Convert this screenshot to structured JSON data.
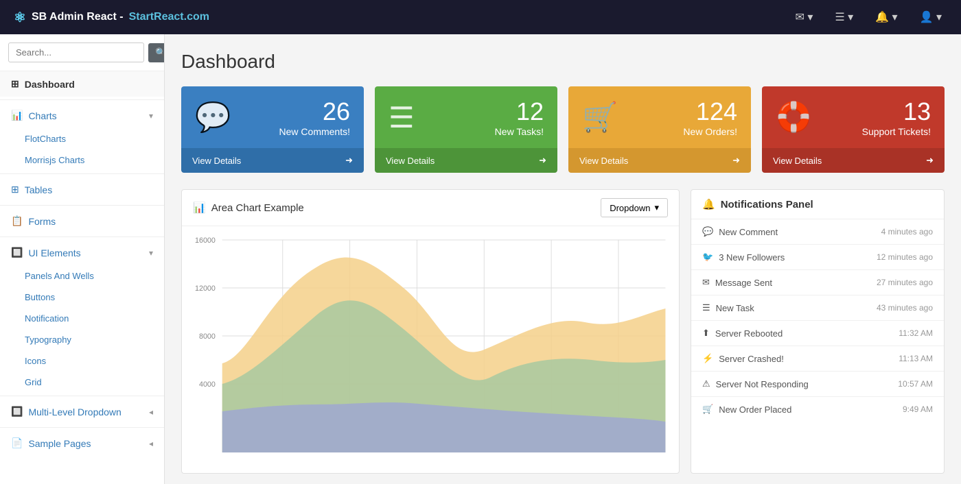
{
  "brand": {
    "icon": "⚛",
    "text": "SB Admin React - ",
    "link": "StartReact.com"
  },
  "topnav": {
    "icons": [
      {
        "name": "mail-icon",
        "symbol": "✉",
        "label": "Mail"
      },
      {
        "name": "list-icon",
        "symbol": "☰",
        "label": "List"
      },
      {
        "name": "bell-icon",
        "symbol": "🔔",
        "label": "Notifications"
      },
      {
        "name": "user-icon",
        "symbol": "👤",
        "label": "User"
      }
    ]
  },
  "sidebar": {
    "search_placeholder": "Search...",
    "items": [
      {
        "id": "dashboard",
        "label": "Dashboard",
        "icon": "⊞",
        "active": true,
        "hasChildren": false
      },
      {
        "id": "charts",
        "label": "Charts",
        "icon": "📊",
        "active": false,
        "hasChildren": true
      },
      {
        "id": "flot-charts",
        "label": "FlotCharts",
        "sub": true
      },
      {
        "id": "morrisjs-charts",
        "label": "Morrisjs Charts",
        "sub": true
      },
      {
        "id": "tables",
        "label": "Tables",
        "icon": "⊞",
        "active": false,
        "hasChildren": false
      },
      {
        "id": "forms",
        "label": "Forms",
        "icon": "📋",
        "active": false,
        "hasChildren": false
      },
      {
        "id": "ui-elements",
        "label": "UI Elements",
        "icon": "🔲",
        "active": false,
        "hasChildren": true
      },
      {
        "id": "panels-wells",
        "label": "Panels And Wells",
        "sub": true
      },
      {
        "id": "buttons",
        "label": "Buttons",
        "sub": true
      },
      {
        "id": "notification",
        "label": "Notification",
        "sub": true
      },
      {
        "id": "typography",
        "label": "Typography",
        "sub": true
      },
      {
        "id": "icons",
        "label": "Icons",
        "sub": true
      },
      {
        "id": "grid",
        "label": "Grid",
        "sub": true
      },
      {
        "id": "multi-level",
        "label": "Multi-Level Dropdown",
        "icon": "🔲",
        "active": false,
        "hasChildren": true
      },
      {
        "id": "sample-pages",
        "label": "Sample Pages",
        "icon": "📄",
        "active": false,
        "hasChildren": true
      }
    ]
  },
  "page": {
    "title": "Dashboard"
  },
  "stat_cards": [
    {
      "id": "comments",
      "number": "26",
      "label": "New Comments!",
      "icon": "💬",
      "footer": "View Details",
      "color_class": "card-blue"
    },
    {
      "id": "tasks",
      "number": "12",
      "label": "New Tasks!",
      "icon": "☰",
      "footer": "View Details",
      "color_class": "card-green"
    },
    {
      "id": "orders",
      "number": "124",
      "label": "New Orders!",
      "icon": "🛒",
      "footer": "View Details",
      "color_class": "card-orange"
    },
    {
      "id": "tickets",
      "number": "13",
      "label": "Support Tickets!",
      "icon": "🛟",
      "footer": "View Details",
      "color_class": "card-red"
    }
  ],
  "chart": {
    "title": "Area Chart Example",
    "dropdown_label": "Dropdown",
    "y_labels": [
      "16000",
      "12000",
      "8000",
      "4000"
    ],
    "colors": {
      "area1": "#f5d08a",
      "area2": "#a8c9a0",
      "area3": "#9fa8d0"
    }
  },
  "notifications": {
    "title": "Notifications Panel",
    "items": [
      {
        "icon": "💬",
        "label": "New Comment",
        "time": "4 minutes ago"
      },
      {
        "icon": "🐦",
        "label": "3 New Followers",
        "time": "12 minutes ago"
      },
      {
        "icon": "✉",
        "label": "Message Sent",
        "time": "27 minutes ago"
      },
      {
        "icon": "☰",
        "label": "New Task",
        "time": "43 minutes ago"
      },
      {
        "icon": "⬆",
        "label": "Server Rebooted",
        "time": "11:32 AM"
      },
      {
        "icon": "⚡",
        "label": "Server Crashed!",
        "time": "11:13 AM"
      },
      {
        "icon": "⚠",
        "label": "Server Not Responding",
        "time": "10:57 AM"
      },
      {
        "icon": "🛒",
        "label": "New Order Placed",
        "time": "9:49 AM"
      }
    ]
  }
}
